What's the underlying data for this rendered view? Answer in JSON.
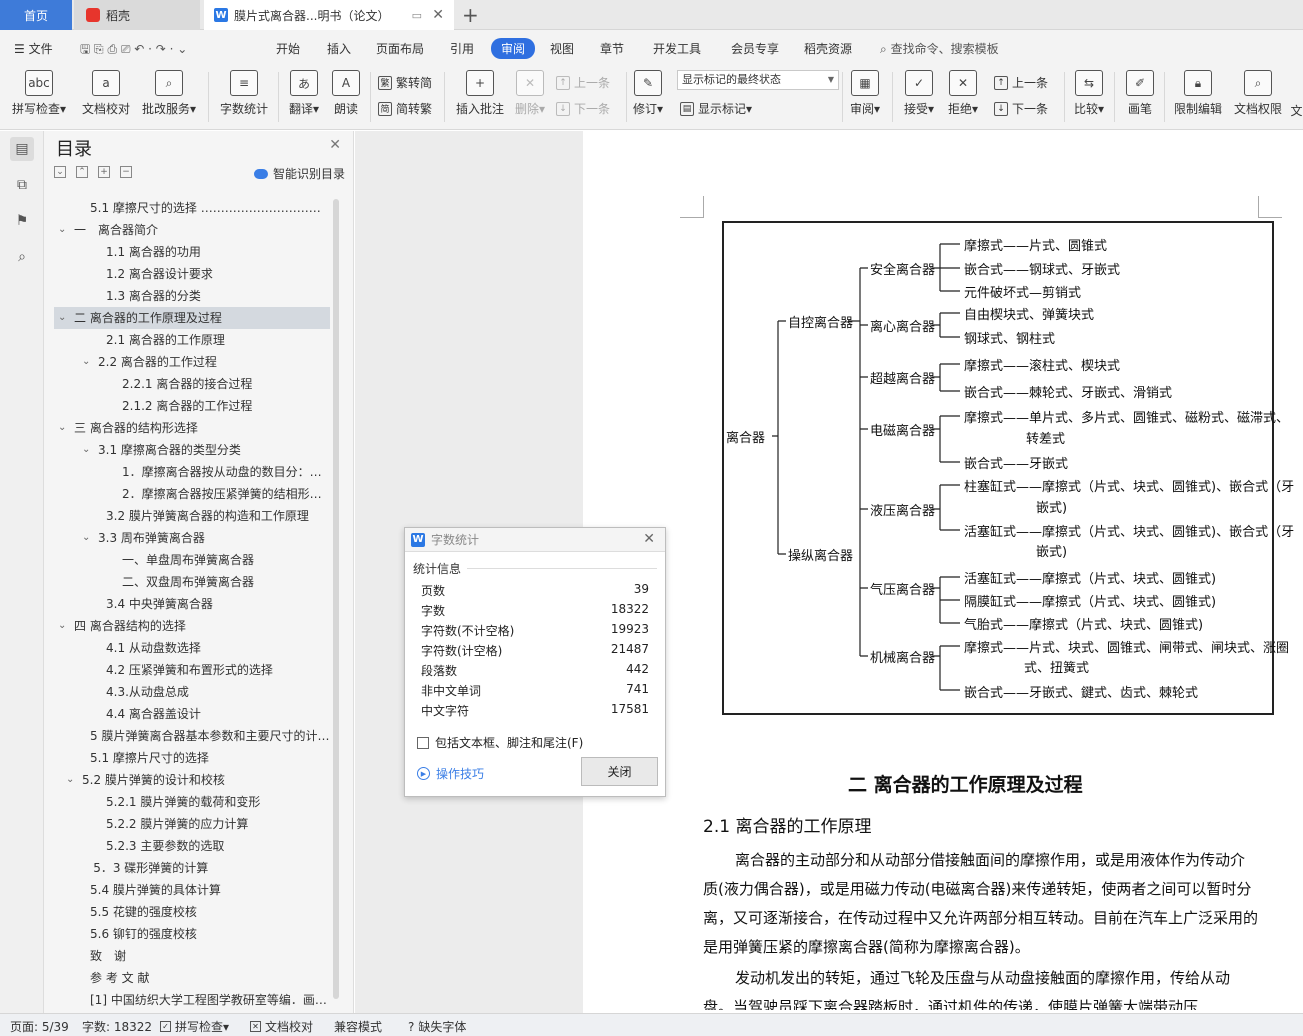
{
  "tabs": {
    "home": "首页",
    "daoke": "稻壳",
    "doc": "膜片式离合器...明书（论文）"
  },
  "menu": {
    "file": "文件",
    "items": [
      "开始",
      "插入",
      "页面布局",
      "引用",
      "审阅",
      "视图",
      "章节",
      "开发工具",
      "会员专享",
      "稻壳资源"
    ],
    "active": "审阅",
    "search": "查找命令、搜索模板"
  },
  "toolbar": {
    "spell": "拼写检查",
    "proof": "文档校对",
    "batch": "批改服务",
    "wordcount": "字数统计",
    "translate": "翻译",
    "read": "朗读",
    "fan": "繁转简",
    "jian": "简转繁",
    "insert_comment": "插入批注",
    "delete": "删除",
    "prev_c": "上一条",
    "next_c": "下一条",
    "revise": "修订",
    "markup_state": "显示标记的最终状态",
    "show_markup": "显示标记",
    "review": "审阅",
    "accept": "接受",
    "reject": "拒绝",
    "prev": "上一条",
    "next": "下一条",
    "compare": "比较",
    "pen": "画笔",
    "restrict": "限制编辑",
    "rights": "文档权限",
    "cut": "文"
  },
  "toc": {
    "title": "目录",
    "smart": "智能识别目录",
    "items": [
      {
        "text": "5.1 摩擦尺寸的选择 ……………………………………",
        "lvl": 1,
        "arrow": ""
      },
      {
        "text": "一　离合器简介",
        "lvl": 0,
        "arrow": "v"
      },
      {
        "text": "1.1 离合器的功用",
        "lvl": 2,
        "arrow": ""
      },
      {
        "text": "1.2 离合器设计要求",
        "lvl": 2,
        "arrow": ""
      },
      {
        "text": "1.3 离合器的分类",
        "lvl": 2,
        "arrow": ""
      },
      {
        "text": "二  离合器的工作原理及过程",
        "lvl": 0,
        "arrow": "v",
        "sel": true
      },
      {
        "text": "2.1  离合器的工作原理",
        "lvl": 2,
        "arrow": ""
      },
      {
        "text": "2.2 离合器的工作过程",
        "lvl": 1.5,
        "arrow": "v"
      },
      {
        "text": "2.2.1 离合器的接合过程",
        "lvl": 3,
        "arrow": ""
      },
      {
        "text": "2.1.2 离合器的工作过程",
        "lvl": 3,
        "arrow": ""
      },
      {
        "text": "三  离合器的结构形选择",
        "lvl": 0,
        "arrow": "v"
      },
      {
        "text": "3.1 摩擦离合器的类型分类",
        "lvl": 1.5,
        "arrow": "v"
      },
      {
        "text": "1．摩擦离合器按从动盘的数目分：单…",
        "lvl": 3,
        "arrow": ""
      },
      {
        "text": "2．摩擦离合器按压紧弹簧的结相形分:…",
        "lvl": 3,
        "arrow": ""
      },
      {
        "text": "3.2 膜片弹簧离合器的构造和工作原理",
        "lvl": 2,
        "arrow": ""
      },
      {
        "text": "3.3 周布弹簧离合器",
        "lvl": 1.5,
        "arrow": "v"
      },
      {
        "text": "一、单盘周布弹簧离合器",
        "lvl": 3,
        "arrow": ""
      },
      {
        "text": "二、双盘周布弹簧离合器",
        "lvl": 3,
        "arrow": ""
      },
      {
        "text": "3.4 中央弹簧离合器",
        "lvl": 2,
        "arrow": ""
      },
      {
        "text": "四  离合器结构的选择",
        "lvl": 0,
        "arrow": "v"
      },
      {
        "text": "4.1 从动盘数选择",
        "lvl": 2,
        "arrow": ""
      },
      {
        "text": "4.2 压紧弹簧和布置形式的选择",
        "lvl": 2,
        "arrow": ""
      },
      {
        "text": "4.3.从动盘总成",
        "lvl": 2,
        "arrow": ""
      },
      {
        "text": "4.4 离合器盖设计",
        "lvl": 2,
        "arrow": ""
      },
      {
        "text": "5 膜片弹簧离合器基本参数和主要尺寸的计…",
        "lvl": 1,
        "arrow": ""
      },
      {
        "text": "5.1 摩擦片尺寸的选择",
        "lvl": 1,
        "arrow": ""
      },
      {
        "text": "5.2 膜片弹簧的设计和校核",
        "lvl": 0.5,
        "arrow": "v"
      },
      {
        "text": "5.2.1 膜片弹簧的载荷和变形",
        "lvl": 2,
        "arrow": ""
      },
      {
        "text": "5.2.2 膜片弹簧的应力计算",
        "lvl": 2,
        "arrow": ""
      },
      {
        "text": "5.2.3    主要参数的选取",
        "lvl": 2,
        "arrow": ""
      },
      {
        "text": "5．3 碟形弹簧的计算",
        "lvl": 1.2,
        "arrow": ""
      },
      {
        "text": "5.4 膜片弹簧的具体计算",
        "lvl": 1,
        "arrow": ""
      },
      {
        "text": "5.5 花键的强度校核",
        "lvl": 1,
        "arrow": ""
      },
      {
        "text": "5.6 铆钉的强度校核",
        "lvl": 1,
        "arrow": ""
      },
      {
        "text": "致　谢",
        "lvl": 1,
        "arrow": ""
      },
      {
        "text": "参 考 文 献",
        "lvl": 1,
        "arrow": ""
      },
      {
        "text": "[1]    中国纺织大学工程图学教研室等编．画…",
        "lvl": 1,
        "arrow": ""
      }
    ]
  },
  "dialog": {
    "title": "字数统计",
    "section": "统计信息",
    "rows": [
      {
        "k": "页数",
        "v": "39"
      },
      {
        "k": "字数",
        "v": "18322"
      },
      {
        "k": "字符数(不计空格)",
        "v": "19923"
      },
      {
        "k": "字符数(计空格)",
        "v": "21487"
      },
      {
        "k": "段落数",
        "v": "442"
      },
      {
        "k": "非中文单词",
        "v": "741"
      },
      {
        "k": "中文字符",
        "v": "17581"
      }
    ],
    "checkbox": "包括文本框、脚注和尾注(F)",
    "tips": "操作技巧",
    "close": "关闭"
  },
  "diagram": {
    "root": "离合器",
    "auto": "自控离合器",
    "manual": "操纵离合器",
    "safe": "安全离合器",
    "centri": "离心离合器",
    "overrun": "超越离合器",
    "electro": "电磁离合器",
    "hydraulic": "液压离合器",
    "pneumatic": "气压离合器",
    "mechanical": "机械离合器",
    "l1": "摩擦式——片式、圆锥式",
    "l2": "嵌合式——钢球式、牙嵌式",
    "l3": "元件破坏式—剪销式",
    "l4": "自由楔块式、弹簧块式",
    "l5": "钢球式、钢柱式",
    "l6": "摩擦式——滚柱式、楔块式",
    "l7": "嵌合式——棘轮式、牙嵌式、滑销式",
    "l8a": "摩擦式——单片式、多片式、圆锥式、磁粉式、磁滞式、",
    "l8b": "转差式",
    "l9": "嵌合式——牙嵌式",
    "l10a": "柱塞缸式——摩擦式（片式、块式、圆锥式)、嵌合式（牙",
    "l10b": "嵌式)",
    "l11a": "活塞缸式——摩擦式（片式、块式、圆锥式)、嵌合式（牙",
    "l11b": "嵌式)",
    "l12": "活塞缸式——摩擦式（片式、块式、圆锥式)",
    "l13": "隔膜缸式——摩擦式（片式、块式、圆锥式)",
    "l14": "气胎式——摩擦式（片式、块式、圆锥式)",
    "l15a": "摩擦式——片式、块式、圆锥式、闸带式、闸块式、涨圈",
    "l15b": "式、扭簧式",
    "l16": "嵌合式——牙嵌式、鍵式、齿式、棘轮式"
  },
  "doc": {
    "h2": "二  离合器的工作原理及过程",
    "h3": "2.1  离合器的工作原理",
    "p1": "离合器的主动部分和从动部分借接触面间的摩擦作用，或是用液体作为传动介质(液力偶合器)，或是用磁力传动(电磁离合器)来传递转矩，使两者之间可以暂时分离，又可逐渐接合，在传动过程中又允许两部分相互转动。目前在汽车上广泛采用的是用弹簧压紧的摩擦离合器(简称为摩擦离合器)。",
    "p2": "   发动机发出的转矩，通过飞轮及压盘与从动盘接触面的摩擦作用，传给从动盘。当驾驶员踩下离合器踏板时，通过机件的传递，使膜片弹簧大端带动压"
  },
  "status": {
    "page": "页面: 5/39",
    "words": "字数: 18322",
    "spell": "拼写检查",
    "proof": "文档校对",
    "compat": "兼容模式",
    "font": "缺失字体"
  }
}
